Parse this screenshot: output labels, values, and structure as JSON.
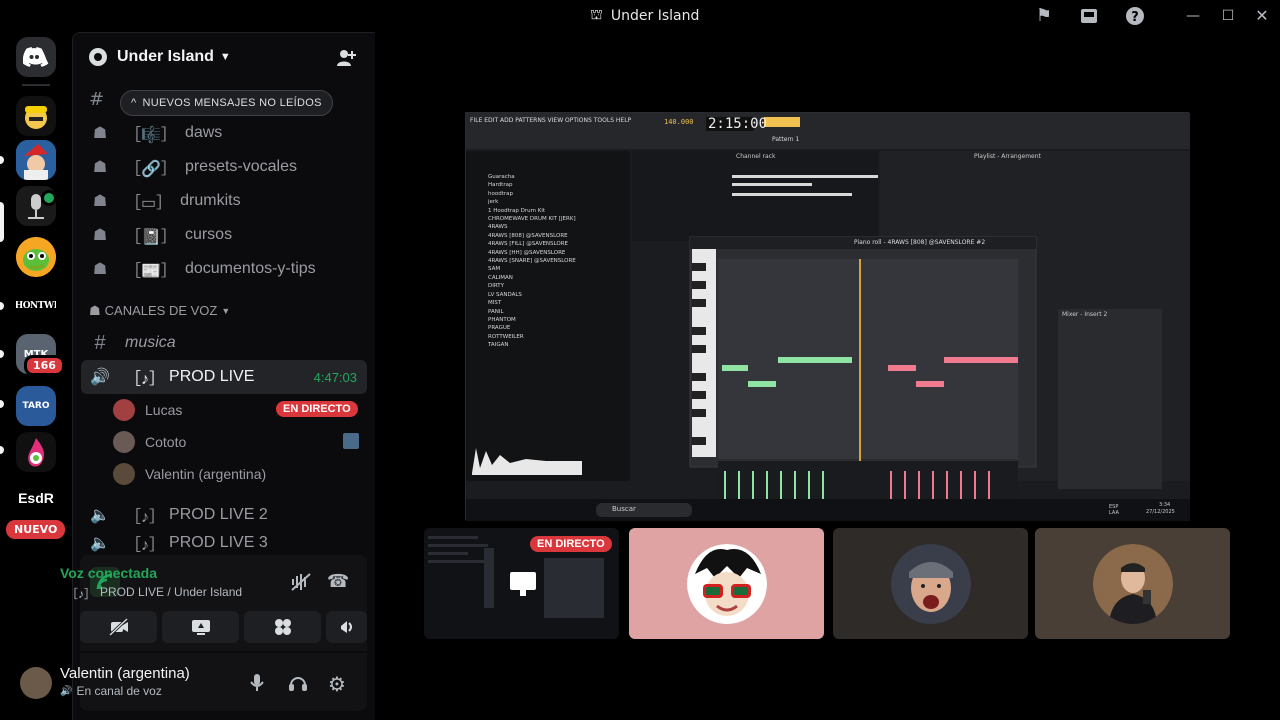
{
  "window": {
    "title": "Under Island"
  },
  "rail": {
    "servers": [
      {
        "name": "discord-home",
        "label": "",
        "color": "#2b2d31"
      },
      {
        "name": "server-worker",
        "label": "",
        "color": "#3a3a3a"
      },
      {
        "name": "server-santa",
        "label": "",
        "color": "#1f6fb5"
      },
      {
        "name": "server-mic",
        "label": "",
        "color": "#1a1a1a"
      },
      {
        "name": "server-bird",
        "label": "",
        "color": "#f0a030"
      },
      {
        "name": "server-hontwi",
        "label": "HONTWI",
        "color": "#000000"
      },
      {
        "name": "server-mtk",
        "label": "MTK",
        "color": "#5a6470"
      },
      {
        "name": "server-taro",
        "label": "TARO",
        "color": "#2a5a9a"
      },
      {
        "name": "server-fire",
        "label": "",
        "color": "#101010"
      },
      {
        "name": "server-esdr",
        "label": "EsdR",
        "color": "#000000"
      }
    ],
    "mtk_badge": "166",
    "new_badge": "NUEVO"
  },
  "sidebar": {
    "guild_name": "Under Island",
    "new_messages_pill": "NUEVOS MENSAJES NO LEÍDOS",
    "text_channels": [
      {
        "label": "daws",
        "prefix": "［🎼］"
      },
      {
        "label": "presets-vocales",
        "prefix": "［🔗］"
      },
      {
        "label": "drumkits",
        "prefix": "［▭］"
      },
      {
        "label": "cursos",
        "prefix": "［📓］"
      },
      {
        "label": "documentos-y-tips",
        "prefix": "［📰］"
      }
    ],
    "voice_category": "CANALES DE VOZ",
    "musica_channel": "musica",
    "prod_live": {
      "label": "PROD LIVE",
      "prefix": "［♪］",
      "timer": "4:47:03"
    },
    "participants": [
      {
        "name": "Lucas",
        "live": "EN DIRECTO"
      },
      {
        "name": "Cototo",
        "live": ""
      },
      {
        "name": "Valentin (argentina)",
        "live": ""
      }
    ],
    "prod_live_2": "PROD LIVE 2",
    "prod_live_3": "PROD LIVE 3"
  },
  "voice_panel": {
    "status": "Voz conectada",
    "location": "PROD LIVE / Under Island",
    "location_prefix": "［♪］"
  },
  "user_panel": {
    "name": "Valentin (argentina)",
    "status": "En canal de voz"
  },
  "stage": {
    "live_label": "EN DIRECTO",
    "daw": {
      "menu": "FILE EDIT ADD PATTERNS VIEW OPTIONS TOOLS HELP",
      "time": "2:15:00",
      "tempo": "140.000",
      "pattern": "Pattern 1",
      "piano_roll_title": "Piano roll - 4RAWS [808] @SAVENSLORE #2",
      "channel_rack": "Channel rack",
      "playlist": "Playlist - Arrangement",
      "mixer": "Mixer - Insert 2",
      "browser_items": [
        "Guaracha",
        "Hardtrap",
        "hoodtrap",
        "jerk",
        "1 Hoodtrap Drum Kit",
        "CHROMEWAVE DRUM KIT [JERK]",
        "4RAWS",
        "4RAWS [808] @SAVENSLORE",
        "4RAWS [FILL] @SAVENSLORE",
        "4RAWS [HH] @SAVENSLORE",
        "4RAWS [SNARE] @SAVENSLORE",
        "SAM",
        "CALIMAN",
        "DIRTY",
        "LV SANDALS",
        "MIST",
        "PANIL",
        "PHANTOM",
        "PRAGUE",
        "ROTTWEILER",
        "TAIGAN"
      ],
      "taskbar_search": "Buscar",
      "taskbar_date": "27/12/2025",
      "taskbar_time": "3:34",
      "taskbar_lang": "ESP LAA"
    }
  },
  "colors": {
    "accent_green": "#23a55a",
    "live_red": "#da373c",
    "note_green": "#8fe3a3",
    "note_pink": "#f07b8e",
    "playhead": "#d6a23a",
    "tile_pink": "#e0a3a3",
    "tile_dark": "#2e2b29",
    "tile_brown": "#4a3f37"
  }
}
